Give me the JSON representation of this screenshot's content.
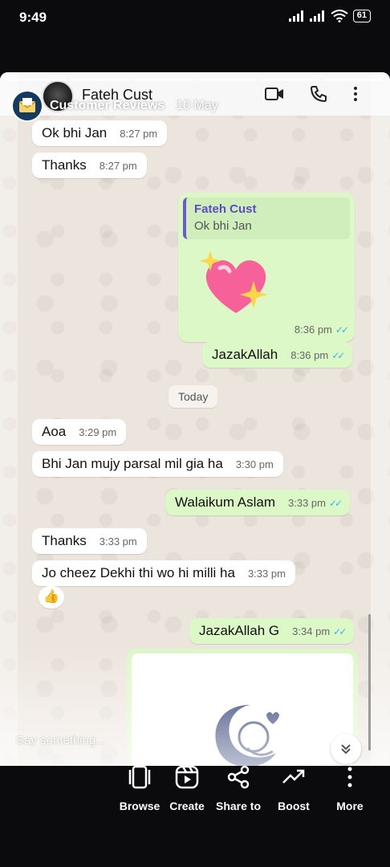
{
  "status_bar": {
    "time": "9:49",
    "battery": "61"
  },
  "story": {
    "owner_name": "Customer Reviews",
    "date": "10 May",
    "comment_placeholder": "Say something..."
  },
  "chat": {
    "contact_name": "Fateh Cust",
    "messages": [
      {
        "text": "Ok bhi Jan",
        "time": "8:27 pm",
        "dir": "in"
      },
      {
        "text": "Thanks",
        "time": "8:27 pm",
        "dir": "in"
      },
      {
        "quote_name": "Fateh Cust",
        "quote_text": "Ok bhi Jan",
        "time": "8:36 pm",
        "dir": "out",
        "sticker": "sparkling-heart"
      },
      {
        "text": "JazakAllah",
        "time": "8:36 pm",
        "dir": "out"
      },
      {
        "date_chip": "Today"
      },
      {
        "text": "Aoa",
        "time": "3:29 pm",
        "dir": "in"
      },
      {
        "text": "Bhi Jan mujy parsal mil gia ha",
        "time": "3:30 pm",
        "dir": "in"
      },
      {
        "text": "Walaikum Aslam",
        "time": "3:33 pm",
        "dir": "out"
      },
      {
        "text": "Thanks",
        "time": "3:33 pm",
        "dir": "in"
      },
      {
        "text": "Jo cheez Dekhi thi wo hi milli ha",
        "time": "3:33 pm",
        "dir": "in",
        "reaction": "👍"
      },
      {
        "text": "JazakAllah G",
        "time": "3:34 pm",
        "dir": "out"
      }
    ],
    "tick_color": "#34b7f1",
    "outgoing_bg": "#dcf8c6",
    "incoming_bg": "#ffffff"
  },
  "actions": [
    {
      "label": "Browse",
      "icon": "browse-icon"
    },
    {
      "label": "Create",
      "icon": "reel-icon"
    },
    {
      "label": "Share to",
      "icon": "share-icon"
    },
    {
      "label": "Boost",
      "icon": "trend-icon"
    },
    {
      "label": "More",
      "icon": "more-vertical-icon"
    }
  ]
}
